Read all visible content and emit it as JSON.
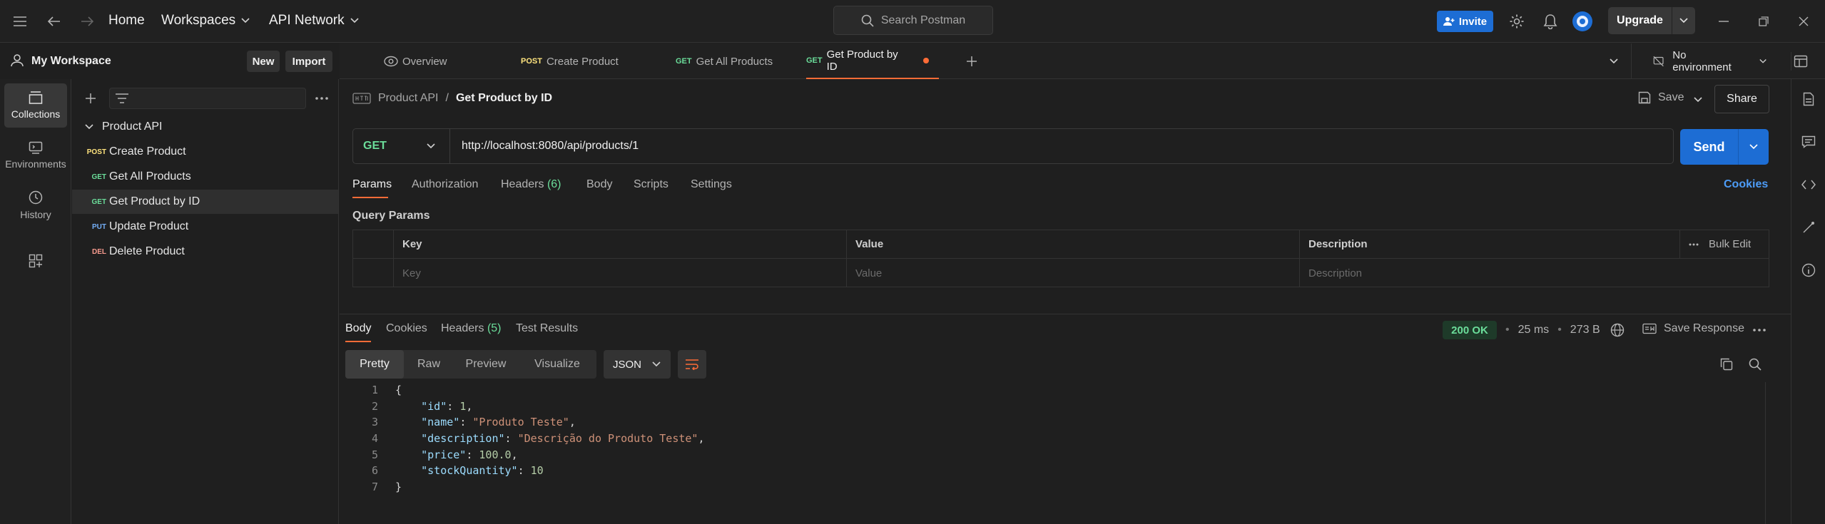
{
  "topbar": {
    "home": "Home",
    "workspaces": "Workspaces",
    "api_network": "API Network",
    "search_placeholder": "Search Postman",
    "invite": "Invite",
    "upgrade": "Upgrade"
  },
  "workspace": {
    "title": "My Workspace",
    "new_btn": "New",
    "import_btn": "Import"
  },
  "rail": [
    {
      "label": "Collections",
      "icon": "collections-icon",
      "active": true
    },
    {
      "label": "Environments",
      "icon": "environments-icon",
      "active": false
    },
    {
      "label": "History",
      "icon": "history-icon",
      "active": false
    }
  ],
  "collection": {
    "name": "Product API",
    "requests": [
      {
        "method": "POST",
        "name": "Create Product"
      },
      {
        "method": "GET",
        "name": "Get All Products"
      },
      {
        "method": "GET",
        "name": "Get Product by ID"
      },
      {
        "method": "PUT",
        "name": "Update Product"
      },
      {
        "method": "DEL",
        "name": "Delete Product"
      }
    ]
  },
  "tabs": [
    {
      "method": "",
      "label": "Overview"
    },
    {
      "method": "POST",
      "label": "Create Product"
    },
    {
      "method": "GET",
      "label": "Get All Products"
    },
    {
      "method": "GET",
      "label": "Get Product by ID"
    }
  ],
  "environment": "No environment",
  "breadcrumb": {
    "collection": "Product API",
    "separator": "/",
    "request": "Get Product by ID"
  },
  "actions": {
    "save": "Save",
    "share": "Share"
  },
  "request": {
    "method": "GET",
    "url": "http://localhost:8080/api/products/1",
    "send": "Send"
  },
  "request_tabs": {
    "params": "Params",
    "authorization": "Authorization",
    "headers": "Headers",
    "headers_count": "(6)",
    "body": "Body",
    "scripts": "Scripts",
    "settings": "Settings",
    "cookies": "Cookies"
  },
  "query_params": {
    "title": "Query Params",
    "headers": {
      "key": "Key",
      "value": "Value",
      "description": "Description",
      "bulk_edit": "Bulk Edit"
    },
    "placeholders": {
      "key": "Key",
      "value": "Value",
      "description": "Description"
    }
  },
  "response": {
    "tabs": {
      "body": "Body",
      "cookies": "Cookies",
      "headers": "Headers",
      "headers_count": "(5)",
      "test_results": "Test Results"
    },
    "status": "200 OK",
    "time": "25 ms",
    "size": "273 B",
    "save_response": "Save Response",
    "views": [
      "Pretty",
      "Raw",
      "Preview",
      "Visualize"
    ],
    "format": "JSON",
    "lines": [
      {
        "n": "1",
        "text": "{"
      },
      {
        "n": "2",
        "key": "\"id\"",
        "val": "1",
        "type": "num",
        "comma": ","
      },
      {
        "n": "3",
        "key": "\"name\"",
        "val": "\"Produto Teste\"",
        "type": "str",
        "comma": ","
      },
      {
        "n": "4",
        "key": "\"description\"",
        "val": "\"Descrição do Produto Teste\"",
        "type": "str",
        "comma": ","
      },
      {
        "n": "5",
        "key": "\"price\"",
        "val": "100.0",
        "type": "num",
        "comma": ","
      },
      {
        "n": "6",
        "key": "\"stockQuantity\"",
        "val": "10",
        "type": "num",
        "comma": ""
      },
      {
        "n": "7",
        "text": "}"
      }
    ]
  },
  "colors": {
    "accent_orange": "#ff6c37",
    "primary_blue": "#1d6dd4",
    "get_green": "#6bdd9a",
    "post_yellow": "#ffe47e",
    "put_blue": "#74aef6",
    "del_red": "#f79a8e"
  }
}
